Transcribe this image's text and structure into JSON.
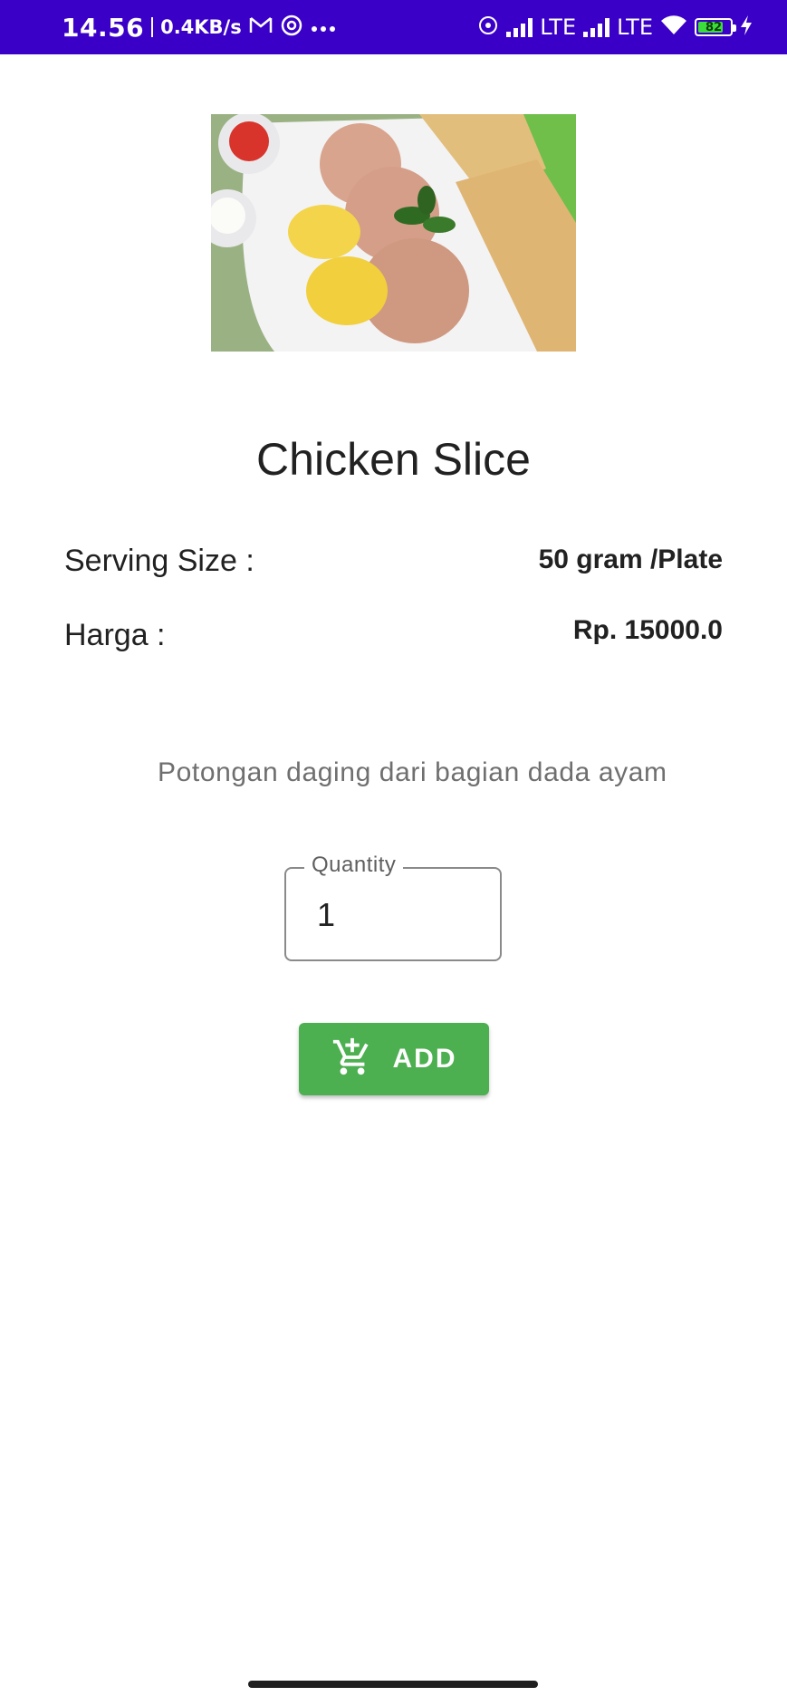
{
  "status_bar": {
    "time": "14.56",
    "net_speed": "0.4KB/s",
    "sim1_label": "LTE",
    "sim2_label": "LTE",
    "battery_level": "82",
    "battery_fraction": 0.82,
    "icons": [
      "gmail-icon",
      "sync-icon",
      "more-dots-icon",
      "hotspot-icon",
      "signal-icon",
      "wifi-icon",
      "battery-icon",
      "charging-icon"
    ]
  },
  "product": {
    "name": "Chicken Slice",
    "image_icon": "food-photo",
    "serving_size_label": "Serving Size :",
    "serving_size_value": "50 gram /Plate",
    "price_label": "Harga :",
    "price_value": "Rp. 15000.0",
    "description": "Potongan daging dari bagian dada ayam"
  },
  "quantity_field": {
    "label": "Quantity",
    "value": "1"
  },
  "add_button": {
    "label": "ADD",
    "icon": "add-shopping-cart-icon",
    "color": "#4caf50"
  },
  "theme": {
    "status_bar_color": "#3a00c8"
  }
}
